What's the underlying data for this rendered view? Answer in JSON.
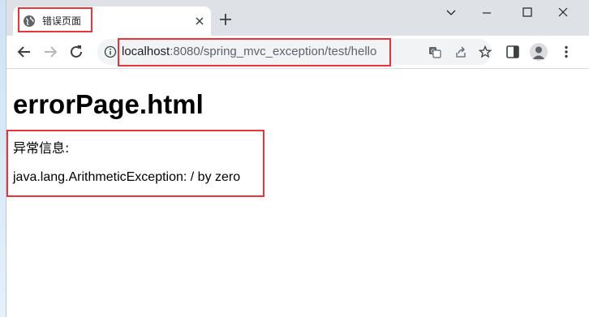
{
  "tab": {
    "title": "错误页面",
    "favicon": "globe-icon",
    "close_icon": "close-icon",
    "new_tab_icon": "plus-icon"
  },
  "window_controls": [
    "chevron-down-icon",
    "minimize-icon",
    "maximize-icon",
    "close-icon"
  ],
  "toolbar": {
    "back_icon": "arrow-left-icon",
    "forward_icon": "arrow-right-icon",
    "reload_icon": "reload-icon",
    "site_info_icon": "info-icon",
    "url_host": "localhost",
    "url_rest": ":8080/spring_mvc_exception/test/hello",
    "omnibox_icons": [
      "translate-icon",
      "share-icon",
      "star-icon"
    ],
    "side_panel_icon": "side-panel-icon",
    "profile_icon": "avatar-icon",
    "menu_icon": "more-vertical-icon"
  },
  "page": {
    "heading": "errorPage.html",
    "message_label": "异常信息:",
    "message_value": "java.lang.ArithmeticException: / by zero"
  },
  "colors": {
    "highlight": "#e8333a",
    "tabstrip": "#dee1e6",
    "omnibox": "#f1f3f4"
  }
}
